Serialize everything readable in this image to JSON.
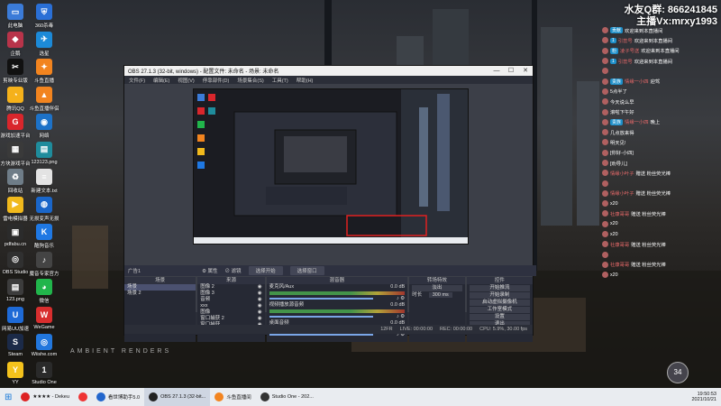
{
  "desktop_icons": [
    {
      "label": "此电脑",
      "color": "#3b7bd8",
      "glyph": "▭"
    },
    {
      "label": "360杀毒",
      "color": "#2a6fd6",
      "glyph": "⛨"
    },
    {
      "label": "企鹅",
      "color": "#b8344a",
      "glyph": "◆"
    },
    {
      "label": "选星",
      "color": "#1c8ad8",
      "glyph": "✈"
    },
    {
      "label": "剪映专业版",
      "color": "#111111",
      "glyph": "✂"
    },
    {
      "label": "斗鱼直播",
      "color": "#f2841f",
      "glyph": "✦"
    },
    {
      "label": "腾讯QQ",
      "color": "#f5b11a",
      "glyph": "◔"
    },
    {
      "label": "斗鱼直播伴侣",
      "color": "#f2841f",
      "glyph": "▲"
    },
    {
      "label": "游戏加速平台",
      "color": "#d9262c",
      "glyph": "G"
    },
    {
      "label": "网络",
      "color": "#1d72c8",
      "glyph": "◉"
    },
    {
      "label": "方块游戏平台",
      "color": "#3a3a3a",
      "glyph": "▦"
    },
    {
      "label": "123123.png",
      "color": "#1f8c9c",
      "glyph": "▤"
    },
    {
      "label": "回收站",
      "color": "#6f7d88",
      "glyph": "♻"
    },
    {
      "label": "新建文本.txt",
      "color": "#e3e3e3",
      "glyph": "≡"
    },
    {
      "label": "雷电模拟器",
      "color": "#f1b91c",
      "glyph": "▶"
    },
    {
      "label": "无损变声无损",
      "color": "#1a66c9",
      "glyph": "◍"
    },
    {
      "label": "pdfabu.cn",
      "color": "#2b2b2b",
      "glyph": "▣"
    },
    {
      "label": "酷狗音乐",
      "color": "#1f78e3",
      "glyph": "K"
    },
    {
      "label": "OBS Studio",
      "color": "#303030",
      "glyph": "◎"
    },
    {
      "label": "魔音专家官方",
      "color": "#444444",
      "glyph": "♪"
    },
    {
      "label": "123.png",
      "color": "#3c3c3c",
      "glyph": "▤"
    },
    {
      "label": "微信",
      "color": "#21b54b",
      "glyph": "◕"
    },
    {
      "label": "网易UU加速",
      "color": "#1e6ad6",
      "glyph": "U"
    },
    {
      "label": "WeGame",
      "color": "#d82e2e",
      "glyph": "W"
    },
    {
      "label": "Steam",
      "color": "#1b2a48",
      "glyph": "S"
    },
    {
      "label": "Wiishe.com",
      "color": "#2277dd",
      "glyph": "◎"
    },
    {
      "label": "YY",
      "color": "#f4c21c",
      "glyph": "Y"
    },
    {
      "label": "Studio One",
      "color": "#2a2a2a",
      "glyph": "1"
    }
  ],
  "overlay": {
    "qq": "水友Q群: 866241845",
    "anchor": "主播Vx:mrxy1993"
  },
  "obs": {
    "title": "OBS 27.1.3 (32-bit, windows) - 配置文件: 未命名 - 场景: 未命名",
    "menu": [
      "文件(F)",
      "编辑(E)",
      "视图(V)",
      "停靠部件(D)",
      "场景集合(S)",
      "工具(T)",
      "帮助(H)"
    ],
    "source_label": "广告1",
    "props_btn": "⚙ 属性",
    "filter_btn": "⊘ 滤镜",
    "select_btn": "选择开始",
    "select_btn2": "选择窗口",
    "docks": {
      "scenes": "场景",
      "sources": "来源",
      "mixer": "混音器",
      "transitions": "转场特效",
      "controls": "控件"
    },
    "scenes": [
      "场景",
      "场景 2"
    ],
    "sources": [
      "图像 2",
      "图像 3",
      "音频",
      "xxx",
      "图像",
      "窗口捕获 2",
      "窗口捕获"
    ],
    "mixer": [
      "麦克风/Aux",
      "视频播放源音频",
      "桌面音频"
    ],
    "mixer_db": [
      "0.0 dB",
      "0.0 dB",
      "0.0 dB"
    ],
    "transitions": {
      "type": "淡出",
      "label": "时长",
      "duration": "300 ms"
    },
    "controls": [
      "开始推流",
      "开始录制",
      "启动虚拟摄像机",
      "工作室模式",
      "设置",
      "退出"
    ],
    "status": {
      "live": "LIVE: 00:00:00",
      "rec": "REC: 00:00:00",
      "cpu": "CPU: 5.9%, 30.00 fps",
      "bitrate": "12FR"
    }
  },
  "chat": [
    {
      "badge": "贡献",
      "name": "",
      "text": "欢迎来到本直播间"
    },
    {
      "badge": "1",
      "name": "引蕊号",
      "text": "欢迎来到本直播间"
    },
    {
      "badge": "粉",
      "name": "凌子号送",
      "text": "欢迎来到本直播间"
    },
    {
      "badge": "1",
      "name": "引蕊号",
      "text": "欢迎来到本直播间"
    },
    {
      "badge": "",
      "name": "",
      "text": ""
    },
    {
      "badge": "贵族",
      "name": "情缘一小四",
      "text": "迎驾"
    },
    {
      "badge": "",
      "name": "",
      "text": "5点半了"
    },
    {
      "badge": "",
      "name": "",
      "text": "今天说么早"
    },
    {
      "badge": "",
      "name": "",
      "text": "滚啦下午好"
    },
    {
      "badge": "贵族",
      "name": "情缘一小四",
      "text": "晚上"
    },
    {
      "badge": "",
      "name": "",
      "text": "几点放来得"
    },
    {
      "badge": "",
      "name": "",
      "text": "明天见!"
    },
    {
      "badge": "",
      "name": "",
      "text": "[你好-小四]"
    },
    {
      "badge": "",
      "name": "",
      "text": "[劝导儿]"
    },
    {
      "badge": "",
      "name": "情缘小叶子",
      "text": "赠送 粉丝荧光棒"
    },
    {
      "badge": "",
      "name": "",
      "text": ""
    },
    {
      "badge": "",
      "name": "情缘小叶子",
      "text": "赠送 粉丝荧光棒"
    },
    {
      "badge": "",
      "name": "",
      "text": "x20"
    },
    {
      "badge": "",
      "name": "社康哥哥",
      "text": "赠送 粉丝荧光棒"
    },
    {
      "badge": "",
      "name": "",
      "text": "x20"
    },
    {
      "badge": "",
      "name": "",
      "text": "x20"
    },
    {
      "badge": "",
      "name": "社康哥哥",
      "text": "赠送 粉丝荧光棒"
    },
    {
      "badge": "",
      "name": "",
      "text": ""
    },
    {
      "badge": "",
      "name": "社康哥哥",
      "text": "赠送 粉丝荧光棒"
    },
    {
      "badge": "",
      "name": "",
      "text": "x20"
    }
  ],
  "badge_count": "34",
  "watermark": "AMBIENT RENDERS",
  "taskbar": {
    "items": [
      {
        "label": "★★★★ - Dekeu",
        "color": "#d22"
      },
      {
        "label": "",
        "color": "#e33"
      },
      {
        "label": "看世博助手5.0",
        "color": "#2266cc"
      },
      {
        "label": "OBS 27.1.3 (32-bit...",
        "color": "#222"
      },
      {
        "label": "斗鱼直播间",
        "color": "#f2841f"
      },
      {
        "label": "Studio One - 202...",
        "color": "#333"
      }
    ],
    "time": "19:50:53",
    "date": "2021/10/21"
  }
}
